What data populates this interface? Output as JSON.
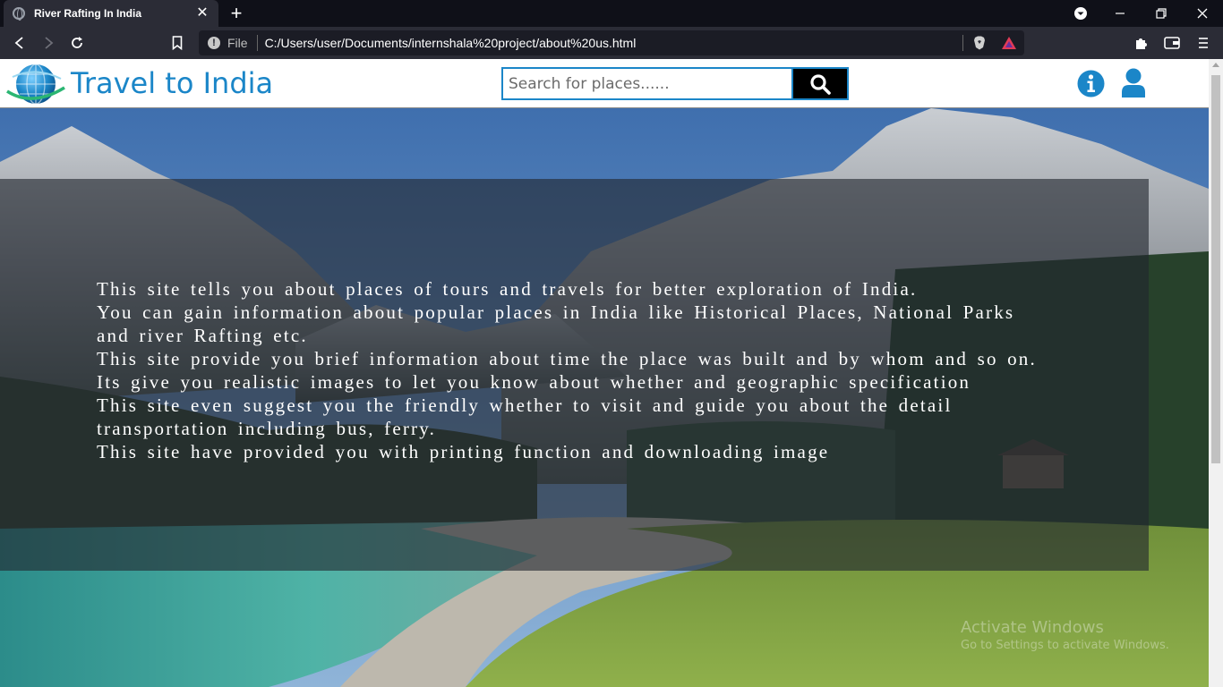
{
  "browser": {
    "tab_title": "River Rafting In India",
    "tab_close": "✕",
    "new_tab": "+",
    "file_label": "File",
    "url": "C:/Users/user/Documents/internshala%20project/about%20us.html"
  },
  "site": {
    "title": "Travel to India",
    "search_placeholder": "Search for places......",
    "brand_color": "#1b86c8"
  },
  "about": {
    "lines": [
      "This site tells you about places of tours and travels for better exploration of India.",
      "You can gain information about popular places in India like Historical Places, National Parks and river Rafting etc.",
      "This site provide you brief information about time the place was built and by whom and so on.",
      "Its give you realistic images to let you know about whether and geographic specification",
      "This site even suggest you the friendly whether to visit and guide you about the detail transportation including bus, ferry.",
      "This site have provided you with printing function and downloading image"
    ]
  },
  "watermark": {
    "title": "Activate Windows",
    "subtitle": "Go to Settings to activate Windows."
  },
  "icons": [
    "globe-icon",
    "close-icon",
    "plus-icon",
    "download-icon",
    "minimize-icon",
    "restore-icon",
    "back-icon",
    "forward-icon",
    "reload-icon",
    "bookmark-icon",
    "info-icon",
    "brave-shield-icon",
    "brave-rewards-icon",
    "extensions-icon",
    "wallet-icon",
    "menu-icon",
    "search-icon",
    "user-icon"
  ]
}
